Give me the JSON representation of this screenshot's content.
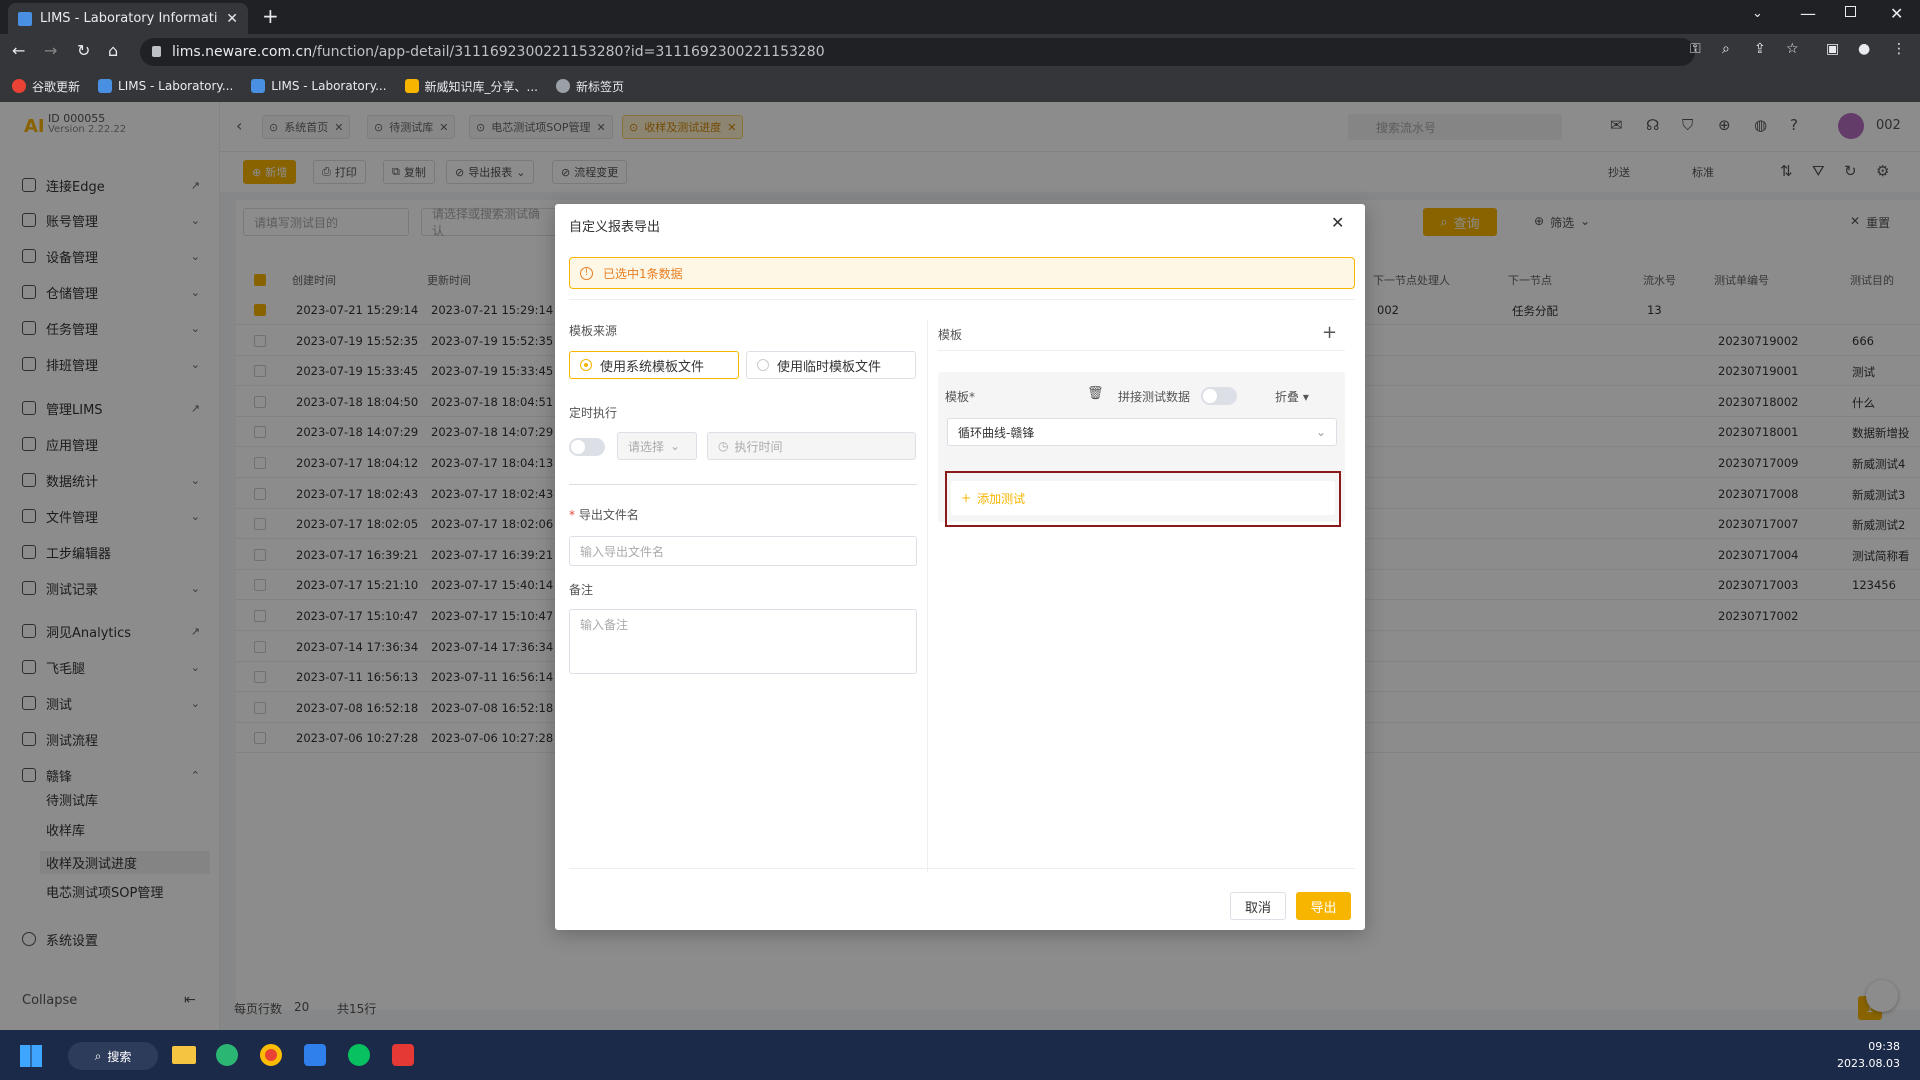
{
  "browser": {
    "tab_title": "LIMS - Laboratory Information",
    "url_domain": "lims.neware.com.cn",
    "url_path": "/function/app-detail/3111692300221153280?id=3111692300221153280",
    "bookmarks": [
      "谷歌更新",
      "LIMS - Laboratory...",
      "LIMS - Laboratory...",
      "新威知识库_分享、...",
      "新标签页"
    ]
  },
  "app": {
    "logo": "AI",
    "id_line1": "ID 000055",
    "id_line2": "Version 2.22.22",
    "user_id": "002",
    "search_placeholder": "搜索流水号",
    "tabs": [
      "系统首页",
      "待测试库",
      "电芯测试项SOP管理",
      "收样及测试进度"
    ],
    "actions": [
      "新增",
      "打印",
      "复制",
      "导出报表",
      "流程变更"
    ],
    "right_actions": [
      "抄送",
      "标准"
    ],
    "filter_placeholder_1": "请填写测试目的",
    "filter_placeholder_2": "请选择或搜索测试确认",
    "query_label": "查询",
    "filter_label": "筛选",
    "reset_label": "重置",
    "pagination": {
      "rows_label": "每页行数",
      "page_size": "20",
      "total": "共15行",
      "current_page": "1"
    }
  },
  "sidebar": {
    "items": [
      {
        "label": "连接Edge"
      },
      {
        "label": "账号管理"
      },
      {
        "label": "设备管理"
      },
      {
        "label": "仓储管理"
      },
      {
        "label": "任务管理"
      },
      {
        "label": "排班管理"
      },
      {
        "label": "管理LIMS"
      },
      {
        "label": "应用管理"
      },
      {
        "label": "数据统计"
      },
      {
        "label": "文件管理"
      },
      {
        "label": "工步编辑器"
      },
      {
        "label": "测试记录"
      },
      {
        "label": "洞见Analytics"
      },
      {
        "label": "飞毛腿"
      },
      {
        "label": "测试"
      },
      {
        "label": "测试流程"
      },
      {
        "label": "赣锋"
      }
    ],
    "sub_items": [
      "待测试库",
      "收样库",
      "收样及测试进度",
      "电芯测试项SOP管理"
    ],
    "settings": "系统设置",
    "collapse": "Collapse"
  },
  "table": {
    "headers": [
      "创建时间",
      "更新时间",
      "下一节点处理人",
      "下一节点",
      "流水号",
      "测试单编号",
      "测试目的"
    ],
    "rows": [
      {
        "created": "2023-07-21 15:29:14",
        "updated": "2023-07-21 15:29:14",
        "handler": "002",
        "node": "任务分配",
        "serial": "13",
        "code": "",
        "purpose": ""
      },
      {
        "created": "2023-07-19 15:52:35",
        "updated": "2023-07-19 15:52:35",
        "handler": "",
        "node": "",
        "serial": "",
        "code": "20230719002",
        "purpose": "666"
      },
      {
        "created": "2023-07-19 15:33:45",
        "updated": "2023-07-19 15:33:45",
        "handler": "",
        "node": "",
        "serial": "",
        "code": "20230719001",
        "purpose": "测试"
      },
      {
        "created": "2023-07-18 18:04:50",
        "updated": "2023-07-18 18:04:51",
        "handler": "",
        "node": "",
        "serial": "",
        "code": "20230718002",
        "purpose": "什么"
      },
      {
        "created": "2023-07-18 14:07:29",
        "updated": "2023-07-18 14:07:29",
        "handler": "",
        "node": "",
        "serial": "",
        "code": "20230718001",
        "purpose": "数据新增投"
      },
      {
        "created": "2023-07-17 18:04:12",
        "updated": "2023-07-17 18:04:13",
        "handler": "",
        "node": "",
        "serial": "",
        "code": "20230717009",
        "purpose": "新威测试4"
      },
      {
        "created": "2023-07-17 18:02:43",
        "updated": "2023-07-17 18:02:43",
        "handler": "",
        "node": "",
        "serial": "",
        "code": "20230717008",
        "purpose": "新威测试3"
      },
      {
        "created": "2023-07-17 18:02:05",
        "updated": "2023-07-17 18:02:06",
        "handler": "",
        "node": "",
        "serial": "",
        "code": "20230717007",
        "purpose": "新威测试2"
      },
      {
        "created": "2023-07-17 16:39:21",
        "updated": "2023-07-17 16:39:21",
        "handler": "",
        "node": "",
        "serial": "",
        "code": "20230717004",
        "purpose": "测试简称看"
      },
      {
        "created": "2023-07-17 15:21:10",
        "updated": "2023-07-17 15:40:14",
        "handler": "",
        "node": "",
        "serial": "",
        "code": "20230717003",
        "purpose": "123456"
      },
      {
        "created": "2023-07-17 15:10:47",
        "updated": "2023-07-17 15:10:47",
        "handler": "",
        "node": "",
        "serial": "",
        "code": "20230717002",
        "purpose": ""
      },
      {
        "created": "2023-07-14 17:36:34",
        "updated": "2023-07-14 17:36:34",
        "handler": "",
        "node": "",
        "serial": "",
        "code": "",
        "purpose": ""
      },
      {
        "created": "2023-07-11 16:56:13",
        "updated": "2023-07-11 16:56:14",
        "handler": "",
        "node": "",
        "serial": "",
        "code": "",
        "purpose": ""
      },
      {
        "created": "2023-07-08 16:52:18",
        "updated": "2023-07-08 16:52:18",
        "handler": "",
        "node": "",
        "serial": "",
        "code": "",
        "purpose": ""
      },
      {
        "created": "2023-07-06 10:27:28",
        "updated": "2023-07-06 10:27:28",
        "handler": "",
        "node": "",
        "serial": "",
        "code": "",
        "purpose": ""
      }
    ]
  },
  "modal": {
    "title": "自定义报表导出",
    "alert": "已选中1条数据",
    "template_source_label": "模板来源",
    "option_system": "使用系统模板文件",
    "option_temp": "使用临时模板文件",
    "schedule_label": "定时执行",
    "select_placeholder": "请选择",
    "time_placeholder": "执行时间",
    "filename_label": "导出文件名",
    "filename_placeholder": "输入导出文件名",
    "remark_label": "备注",
    "remark_placeholder": "输入备注",
    "template_panel_label": "模板",
    "template_field_label": "模板*",
    "concat_label": "拼接测试数据",
    "fold_label": "折叠",
    "template_value": "循环曲线-赣锋",
    "add_test_label": "添加测试",
    "cancel_label": "取消",
    "export_label": "导出"
  },
  "taskbar": {
    "search_label": "搜索",
    "time": "09:38",
    "date": "2023.08.03"
  },
  "colors": {
    "accent": "#f7b500",
    "danger_outline": "#8b1a1a",
    "alert_bg": "#fff7e6"
  }
}
